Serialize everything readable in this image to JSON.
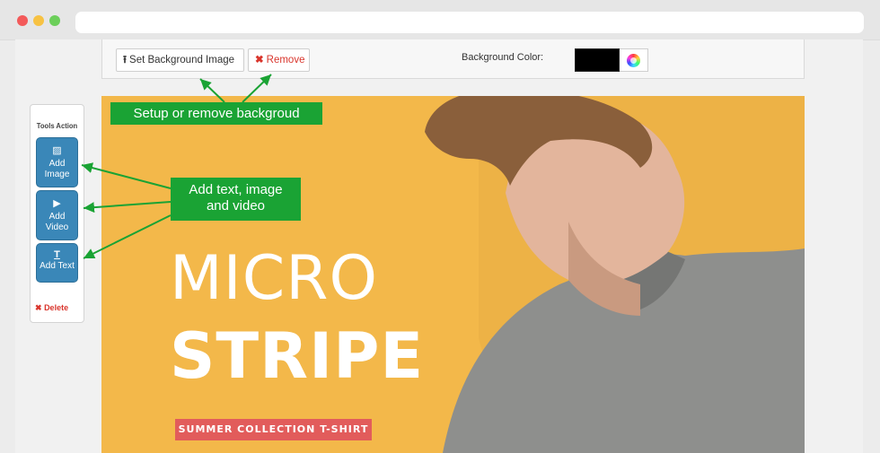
{
  "toolbar": {
    "set_background_label": "Set Background Image",
    "remove_label": "Remove",
    "background_color_label": "Background Color:",
    "background_color": "#000000"
  },
  "tools": {
    "title": "Tools Action",
    "add_image_label": "Add Image",
    "add_video_label": "Add Video",
    "add_text_label": "Add Text",
    "delete_label": "Delete"
  },
  "canvas": {
    "headline_1": "MICRO",
    "headline_2": "STRIPE",
    "tagline": "SUMMER COLLECTION T-SHIRT",
    "background_color": "#f3b84a"
  },
  "callouts": {
    "background": "Setup or remove backgroud",
    "tools_line_1": "Add text, image",
    "tools_line_2": "and video"
  }
}
